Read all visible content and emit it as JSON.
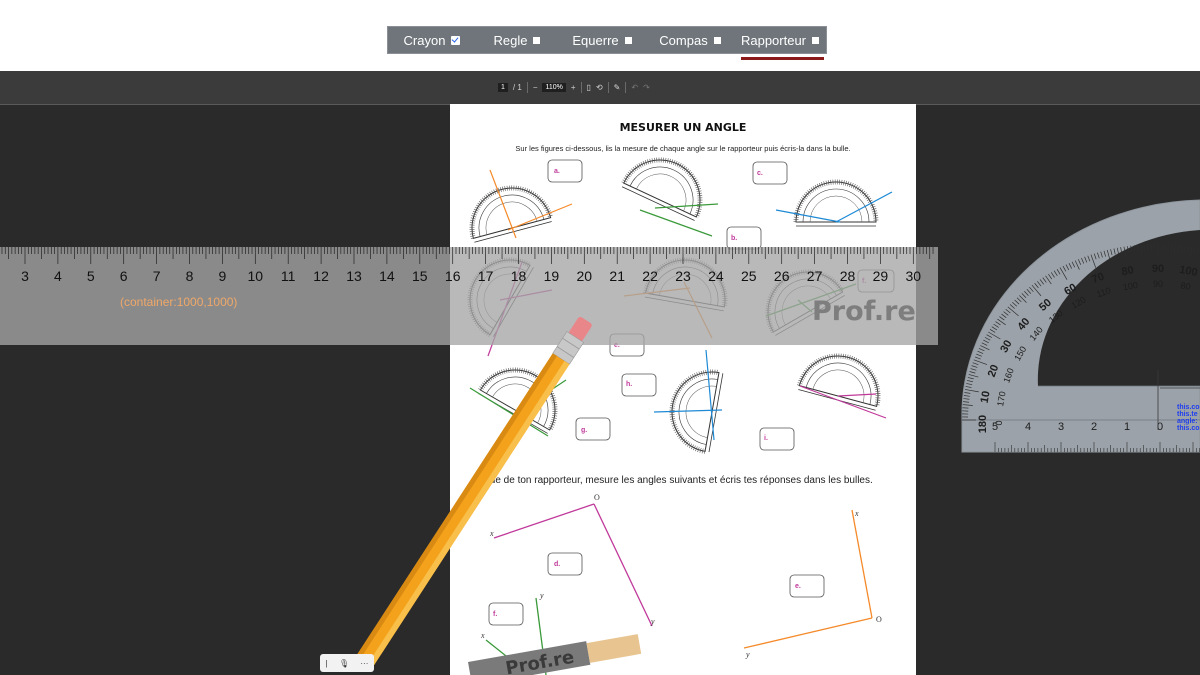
{
  "toolbar": {
    "tools": [
      {
        "label": "Crayon",
        "checked": true
      },
      {
        "label": "Regle",
        "checked": false
      },
      {
        "label": "Equerre",
        "checked": false
      },
      {
        "label": "Compas",
        "checked": false
      },
      {
        "label": "Rapporteur",
        "checked": false
      }
    ],
    "active_tool": "Rapporteur",
    "active_color": "#8b1a1a"
  },
  "viewer": {
    "page_current": "1",
    "page_sep": "/ 1",
    "zoom_minus": "−",
    "zoom_value": "110%",
    "zoom_plus": "+",
    "icons": [
      "fit-page-icon",
      "rotate-icon",
      "draw-icon",
      "undo-icon",
      "redo-icon"
    ]
  },
  "document": {
    "title": "MESURER UN ANGLE",
    "instruction": "Sur les figures ci-dessous, lis la mesure de chaque angle sur le rapporteur puis écris-la dans la bulle.",
    "instruction2": "aide de ton rapporteur, mesure les angles suivants et écris tes réponses dans les bulles.",
    "bubbles_top": [
      "a.",
      "b.",
      "c."
    ],
    "bubbles_mid": [
      "d.",
      "e.",
      "f."
    ],
    "bubbles_row3": [
      "g.",
      "h.",
      "i."
    ],
    "bubbles_bottom": [
      "d.",
      "e.",
      "f."
    ],
    "angle_labels": [
      "O",
      "x",
      "y",
      "x",
      "y",
      "x",
      "y",
      "O",
      "y",
      "O"
    ]
  },
  "ruler": {
    "numbers": [
      "3",
      "4",
      "5",
      "6",
      "7",
      "8",
      "9",
      "10",
      "11",
      "12",
      "13",
      "14",
      "15",
      "16",
      "17",
      "18",
      "19",
      "20",
      "21",
      "22",
      "23",
      "24",
      "25",
      "26",
      "27",
      "28",
      "29",
      "30"
    ],
    "container_text": "(container:1000,1000)",
    "brand": "Prof.re"
  },
  "protractor": {
    "outer_numbers": [
      "180",
      "10",
      "20",
      "30",
      "40",
      "50",
      "60",
      "70",
      "80",
      "90",
      "100"
    ],
    "inner_numbers": [
      "0",
      "170",
      "160",
      "150",
      "140",
      "130",
      "120",
      "110",
      "100",
      "90",
      "80"
    ],
    "ruler_numbers": [
      "5",
      "4",
      "3",
      "2",
      "1",
      "0"
    ],
    "code_text": [
      "this.co",
      "this.te",
      "angle:",
      "this.co"
    ]
  },
  "pencil_brand": "Prof.re",
  "mini_bar": {
    "items": [
      "|",
      "mic-icon",
      "···"
    ]
  },
  "colors": {
    "toolbar_bg": "#6f757b",
    "dark_bg": "#2a2a2a",
    "pencil": "#f4a21c",
    "magenta": "#c0399a",
    "orange": "#f58a2a",
    "green": "#3a9a3a",
    "blue": "#1e8ad6"
  }
}
